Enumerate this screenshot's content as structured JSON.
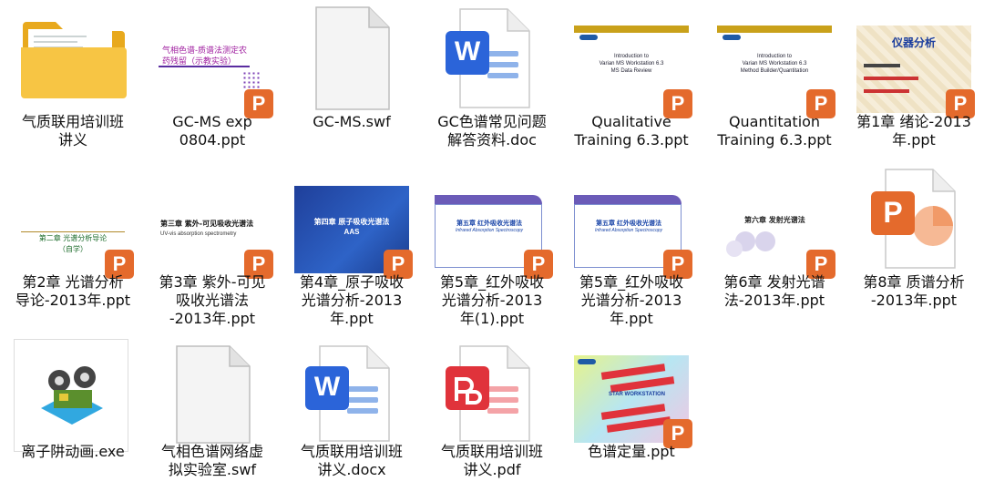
{
  "files": [
    {
      "name": "气质联用培训班\n讲义",
      "kind": "folder"
    },
    {
      "name": "GC-MS exp\n0804.ppt",
      "kind": "ppt",
      "preview": {
        "line1": "气相色谱-质谱法测定农",
        "line2": "药残留（示教实验）"
      }
    },
    {
      "name": "GC-MS.swf",
      "kind": "blank"
    },
    {
      "name": "GC色谱常见问题\n解答资料.doc",
      "kind": "word"
    },
    {
      "name": "Qualitative\nTraining 6.3.ppt",
      "kind": "ppt",
      "preview": {
        "line1": "Introduction to",
        "line2": "Varian MS Workstation 6.3",
        "line3": "MS Data Review"
      }
    },
    {
      "name": "Quantitation\nTraining 6.3.ppt",
      "kind": "ppt",
      "preview": {
        "line1": "Introduction to",
        "line2": "Varian MS Workstation 6.3",
        "line3": "Method Builder/Quantitation"
      }
    },
    {
      "name": "第1章 绪论-2013\n年.ppt",
      "kind": "ppt",
      "preview": {
        "line1": "仪器分析"
      }
    },
    {
      "name": "第2章 光谱分析\n导论-2013年.ppt",
      "kind": "ppt",
      "preview": {
        "line1": "第二章  光谱分析导论",
        "line2": "（自学）"
      }
    },
    {
      "name": "第3章 紫外-可见\n吸收光谱法\n-2013年.ppt",
      "kind": "ppt",
      "preview": {
        "line1": "第三章  紫外-可见吸收光谱法",
        "line2": "UV-vis absorption spectrometry"
      }
    },
    {
      "name": "第4章_原子吸收\n光谱分析-2013\n年.ppt",
      "kind": "ppt",
      "preview": {
        "line1": "第四章  原子吸收光谱法",
        "line2": "AAS"
      }
    },
    {
      "name": "第5章_红外吸收\n光谱分析-2013\n年(1).ppt",
      "kind": "ppt",
      "preview": {
        "line1": "第五章 红外吸收光谱法",
        "line2": "Infrared Absorption Spectroscopy"
      }
    },
    {
      "name": "第5章_红外吸收\n光谱分析-2013\n年.ppt",
      "kind": "ppt",
      "preview": {
        "line1": "第五章 红外吸收光谱法",
        "line2": "Infrared Absorption Spectroscopy"
      }
    },
    {
      "name": "第6章 发射光谱\n法-2013年.ppt",
      "kind": "ppt",
      "preview": {
        "line1": "第六章  发射光谱法"
      }
    },
    {
      "name": "第8章 质谱分析\n-2013年.ppt",
      "kind": "ppt-icon"
    },
    {
      "name": "离子阱动画.exe",
      "kind": "exe"
    },
    {
      "name": "气相色谱网络虚\n拟实验室.swf",
      "kind": "blank"
    },
    {
      "name": "气质联用培训班\n讲义.docx",
      "kind": "word"
    },
    {
      "name": "气质联用培训班\n讲义.pdf",
      "kind": "pdf"
    },
    {
      "name": "色谱定量.ppt",
      "kind": "ppt",
      "preview": {
        "line1": "STAR WORKSTATION"
      }
    }
  ],
  "colors": {
    "ppt_badge": "#e46a2c",
    "word_blue": "#2b64d9",
    "pdf_red": "#e0333b",
    "folder": "#f5c342"
  },
  "badge_letter": "P",
  "word_letter": "W"
}
